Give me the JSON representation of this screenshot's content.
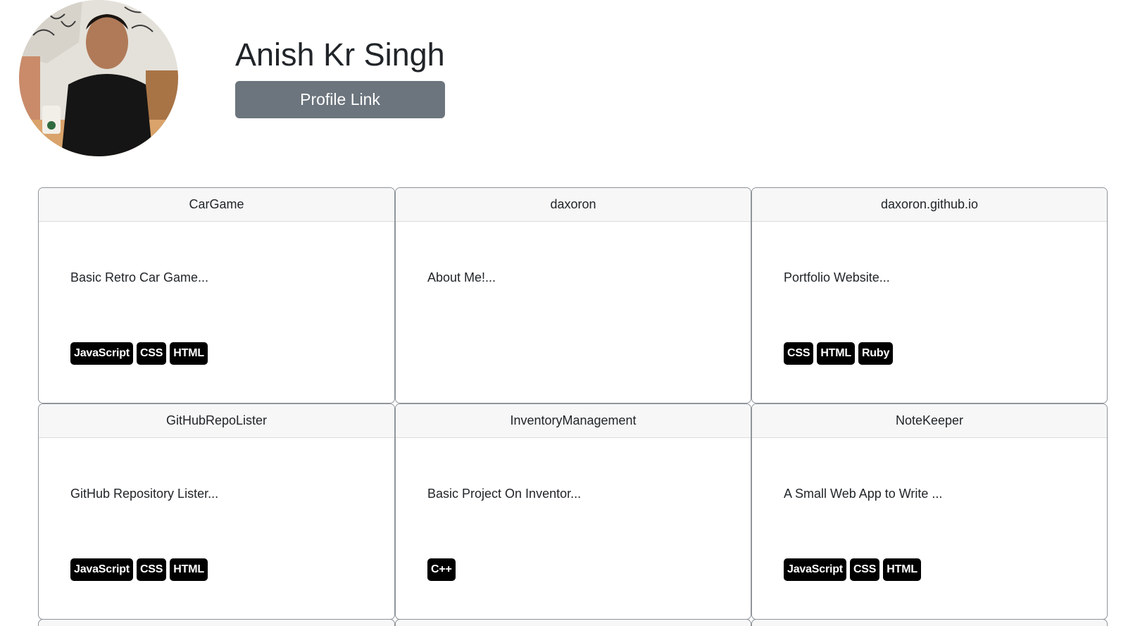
{
  "profile": {
    "name": "Anish Kr Singh",
    "link_label": "Profile Link"
  },
  "repos": [
    {
      "name": "CarGame",
      "description": "Basic Retro Car Game...",
      "languages": [
        "JavaScript",
        "CSS",
        "HTML"
      ]
    },
    {
      "name": "daxoron",
      "description": "About Me!...",
      "languages": []
    },
    {
      "name": "daxoron.github.io",
      "description": "Portfolio Website...",
      "languages": [
        "CSS",
        "HTML",
        "Ruby"
      ]
    },
    {
      "name": "GitHubRepoLister",
      "description": "GitHub Repository Lister...",
      "languages": [
        "JavaScript",
        "CSS",
        "HTML"
      ]
    },
    {
      "name": "InventoryManagement",
      "description": "Basic Project On Inventor...",
      "languages": [
        "C++"
      ]
    },
    {
      "name": "NoteKeeper",
      "description": "A Small Web App to Write ...",
      "languages": [
        "JavaScript",
        "CSS",
        "HTML"
      ]
    }
  ],
  "colors": {
    "button_bg": "#6c757d",
    "badge_bg": "#000000",
    "card_header_bg": "#f7f7f7"
  }
}
